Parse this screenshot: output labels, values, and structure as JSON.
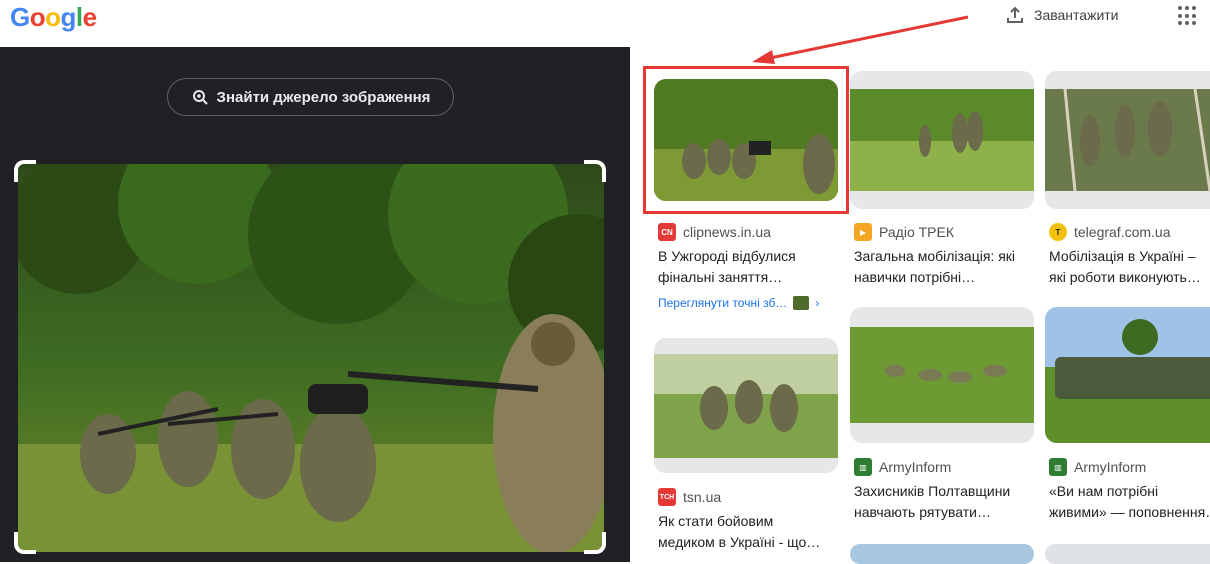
{
  "header": {
    "logo": [
      "G",
      "o",
      "o",
      "g",
      "l",
      "e"
    ],
    "upload_label": "Завантажити",
    "apps_icon": "apps-grid-icon"
  },
  "left_panel": {
    "find_source_label": "Знайти джерело зображення"
  },
  "results": [
    {
      "source": "clipnews.in.ua",
      "favicon_text": "CN",
      "favicon_color": "#e53935",
      "title_lines": [
        "В Ужгороді відбулися",
        "фінальні заняття…"
      ],
      "exact_link": "Переглянути точні зб…"
    },
    {
      "source": "Радіо ТРЕК",
      "favicon_text": "▶",
      "favicon_color": "#f5a623",
      "title_lines": [
        "Загальна мобілізація: які",
        "навички потрібні…"
      ]
    },
    {
      "source": "telegraf.com.ua",
      "favicon_text": "T",
      "favicon_color": "#f4c20d",
      "title_lines": [
        "Мобілізація в Україні –",
        "які роботи виконують…"
      ]
    },
    {
      "source": "tsn.ua",
      "favicon_text": "ТСН",
      "favicon_color": "#e53935",
      "title_lines": [
        "Як стати бойовим",
        "медиком в Україні - що…"
      ]
    },
    {
      "source": "ArmyInform",
      "favicon_text": "▥",
      "favicon_color": "#2e7d32",
      "title_lines": [
        "Захисників Полтавщини",
        "навчають рятувати…"
      ]
    },
    {
      "source": "ArmyInform",
      "favicon_text": "▥",
      "favicon_color": "#2e7d32",
      "title_lines": [
        "«Ви нам потрібні",
        "живими» — поповнення…"
      ]
    }
  ],
  "annotation_color": "#e53935"
}
